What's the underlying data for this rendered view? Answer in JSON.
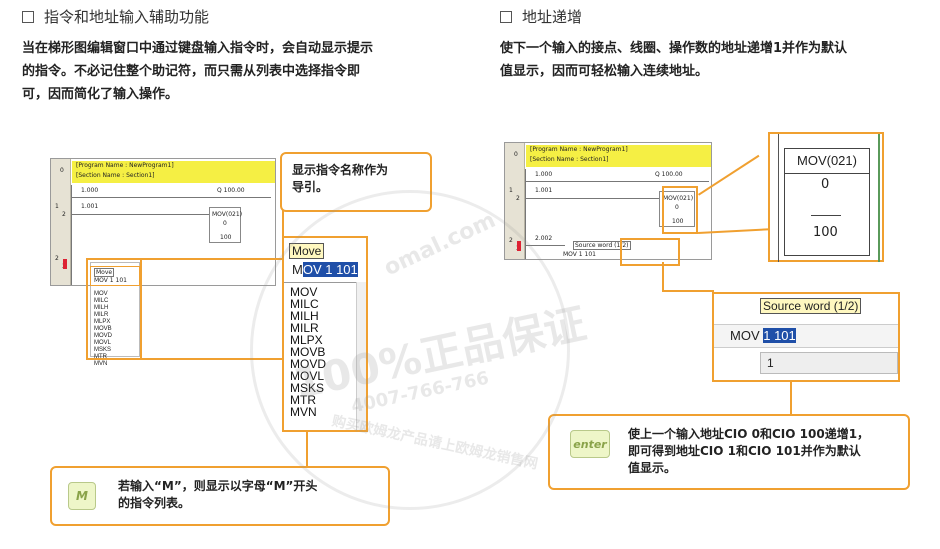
{
  "left": {
    "heading": "指令和地址输入辅助功能",
    "para": [
      "当在梯形图编辑窗口中通过键盘输入指令时，会自动显示提示",
      "的指令。不必记住整个助记符，而只需从列表中选择指令即",
      "可，因而简化了输入操作。"
    ],
    "screen": {
      "program_name": "[Program Name : NewProgram1]",
      "section_name": "[Section Name : Section1]",
      "rungs": [
        "0",
        "1",
        "2",
        "4"
      ],
      "step_nums": [
        "0",
        "2",
        "3"
      ],
      "contacts": [
        "1.000",
        "1.001"
      ],
      "coil": "Q 100.00",
      "fb_name": "MOV(021)",
      "fb_op1": "0",
      "fb_op2": "100",
      "mini_tip": "Move",
      "mini_input": "MOV 1 101",
      "mini_list": [
        "MOV",
        "MILC",
        "MILH",
        "MILR",
        "MLPX",
        "MOVB",
        "MOVD",
        "MOVL",
        "MSKS",
        "MTR",
        "MVN"
      ]
    },
    "callout_top": [
      "显示指令名称作为",
      "导引。"
    ],
    "menu": {
      "tip": "Move",
      "input_prefix": "M",
      "input_sel": "OV 1 101",
      "items": [
        "MOV",
        "MILC",
        "MILH",
        "MILR",
        "MLPX",
        "MOVB",
        "MOVD",
        "MOVL",
        "MSKS",
        "MTR",
        "MVN"
      ]
    },
    "key_label": "M",
    "callout_bottom": [
      "若输入“M”，则显示以字母“M”开头",
      "的指令列表。"
    ]
  },
  "right": {
    "heading": "地址递增",
    "para": [
      "使下一个输入的接点、线圈、操作数的地址递增1并作为默认",
      "值显示，因而可轻松输入连续地址。"
    ],
    "screen": {
      "program_name": "[Program Name : NewProgram1]",
      "section_name": "[Section Name : Section1]",
      "rungs": [
        "0",
        "1",
        "2"
      ],
      "step_nums": [
        "0",
        "2",
        "3"
      ],
      "contacts": [
        "1.000",
        "1.001",
        "2.002"
      ],
      "coil": "Q 100.00",
      "fb_name": "MOV(021)",
      "fb_op1": "0",
      "fb_op2": "100",
      "mini_tip": "Source word (1/2)",
      "mini_input": "MOV 1 101"
    },
    "zoom_box": {
      "name": "MOV(021)",
      "op1": "0",
      "op2": "100"
    },
    "tip_panel": {
      "tip": "Source word (1/2)",
      "prefix": "MOV ",
      "sel": "1 101",
      "value": "1"
    },
    "key_label": "enter",
    "callout": [
      "使上一个输入地址CIO 0和CIO 100递增1，",
      "即可得到地址CIO  1和CIO  101并作为默认",
      "值显示。"
    ]
  },
  "watermark": {
    "site": "omal.com",
    "line1": "100%正品保证",
    "phone": "4007-766-766",
    "line2": "购买欧姆龙产品请上欧姆龙销售网"
  },
  "colors": {
    "accent": "#f0a030",
    "header_yellow": "#f5ef44",
    "selection": "#1f4fa8",
    "key_green": "#eef6c8"
  }
}
